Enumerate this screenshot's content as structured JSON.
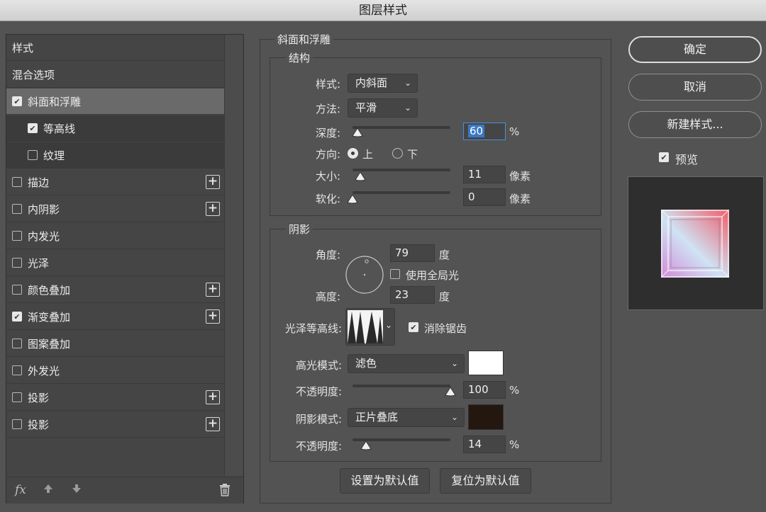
{
  "window": {
    "title": "图层样式"
  },
  "left_list": {
    "items": [
      {
        "label": "样式",
        "checkbox": false,
        "checked": false,
        "indent": 0,
        "plus": false,
        "selected": false
      },
      {
        "label": "混合选项",
        "checkbox": false,
        "checked": false,
        "indent": 0,
        "plus": false,
        "selected": false
      },
      {
        "label": "斜面和浮雕",
        "checkbox": true,
        "checked": true,
        "indent": 0,
        "plus": false,
        "selected": true
      },
      {
        "label": "等高线",
        "checkbox": true,
        "checked": true,
        "indent": 1,
        "plus": false,
        "selected": false
      },
      {
        "label": "纹理",
        "checkbox": true,
        "checked": false,
        "indent": 1,
        "plus": false,
        "selected": false
      },
      {
        "label": "描边",
        "checkbox": true,
        "checked": false,
        "indent": 0,
        "plus": true,
        "selected": false
      },
      {
        "label": "内阴影",
        "checkbox": true,
        "checked": false,
        "indent": 0,
        "plus": true,
        "selected": false
      },
      {
        "label": "内发光",
        "checkbox": true,
        "checked": false,
        "indent": 0,
        "plus": false,
        "selected": false
      },
      {
        "label": "光泽",
        "checkbox": true,
        "checked": false,
        "indent": 0,
        "plus": false,
        "selected": false
      },
      {
        "label": "颜色叠加",
        "checkbox": true,
        "checked": false,
        "indent": 0,
        "plus": true,
        "selected": false
      },
      {
        "label": "渐变叠加",
        "checkbox": true,
        "checked": true,
        "indent": 0,
        "plus": true,
        "selected": false
      },
      {
        "label": "图案叠加",
        "checkbox": true,
        "checked": false,
        "indent": 0,
        "plus": false,
        "selected": false
      },
      {
        "label": "外发光",
        "checkbox": true,
        "checked": false,
        "indent": 0,
        "plus": false,
        "selected": false
      },
      {
        "label": "投影",
        "checkbox": true,
        "checked": false,
        "indent": 0,
        "plus": true,
        "selected": false
      },
      {
        "label": "投影",
        "checkbox": true,
        "checked": false,
        "indent": 0,
        "plus": true,
        "selected": false
      }
    ],
    "footer": {
      "fx_label": "fx",
      "up_icon": "arrow-up-icon",
      "down_icon": "arrow-down-icon",
      "trash_icon": "trash-icon"
    }
  },
  "bevel": {
    "section_title": "斜面和浮雕",
    "structure": {
      "title": "结构",
      "style_label": "样式:",
      "style_value": "内斜面",
      "technique_label": "方法:",
      "technique_value": "平滑",
      "depth_label": "深度:",
      "depth_value": "60",
      "depth_unit": "%",
      "depth_slider": 0.05,
      "direction_label": "方向:",
      "direction_up": "上",
      "direction_down": "下",
      "size_label": "大小:",
      "size_value": "11",
      "size_unit": "像素",
      "size_slider": 0.08,
      "soften_label": "软化:",
      "soften_value": "0",
      "soften_unit": "像素",
      "soften_slider": 0.0
    },
    "shading": {
      "title": "阴影",
      "angle_label": "角度:",
      "angle_value": "79",
      "angle_unit": "度",
      "global_light_label": "使用全局光",
      "altitude_label": "高度:",
      "altitude_value": "23",
      "altitude_unit": "度",
      "gloss_contour_label": "光泽等高线:",
      "anti_alias_label": "消除锯齿",
      "highlight_mode_label": "高光模式:",
      "highlight_mode_value": "滤色",
      "highlight_color": "#ffffff",
      "highlight_opacity_label": "不透明度:",
      "highlight_opacity_value": "100",
      "highlight_opacity_unit": "%",
      "highlight_opacity_slider": 1.0,
      "shadow_mode_label": "阴影模式:",
      "shadow_mode_value": "正片叠底",
      "shadow_color": "#231710",
      "shadow_opacity_label": "不透明度:",
      "shadow_opacity_value": "14",
      "shadow_opacity_unit": "%",
      "shadow_opacity_slider": 0.14
    },
    "make_default_label": "设置为默认值",
    "reset_default_label": "复位为默认值"
  },
  "right_panel": {
    "ok_label": "确定",
    "cancel_label": "取消",
    "new_style_label": "新建样式...",
    "preview_label": "预览"
  }
}
